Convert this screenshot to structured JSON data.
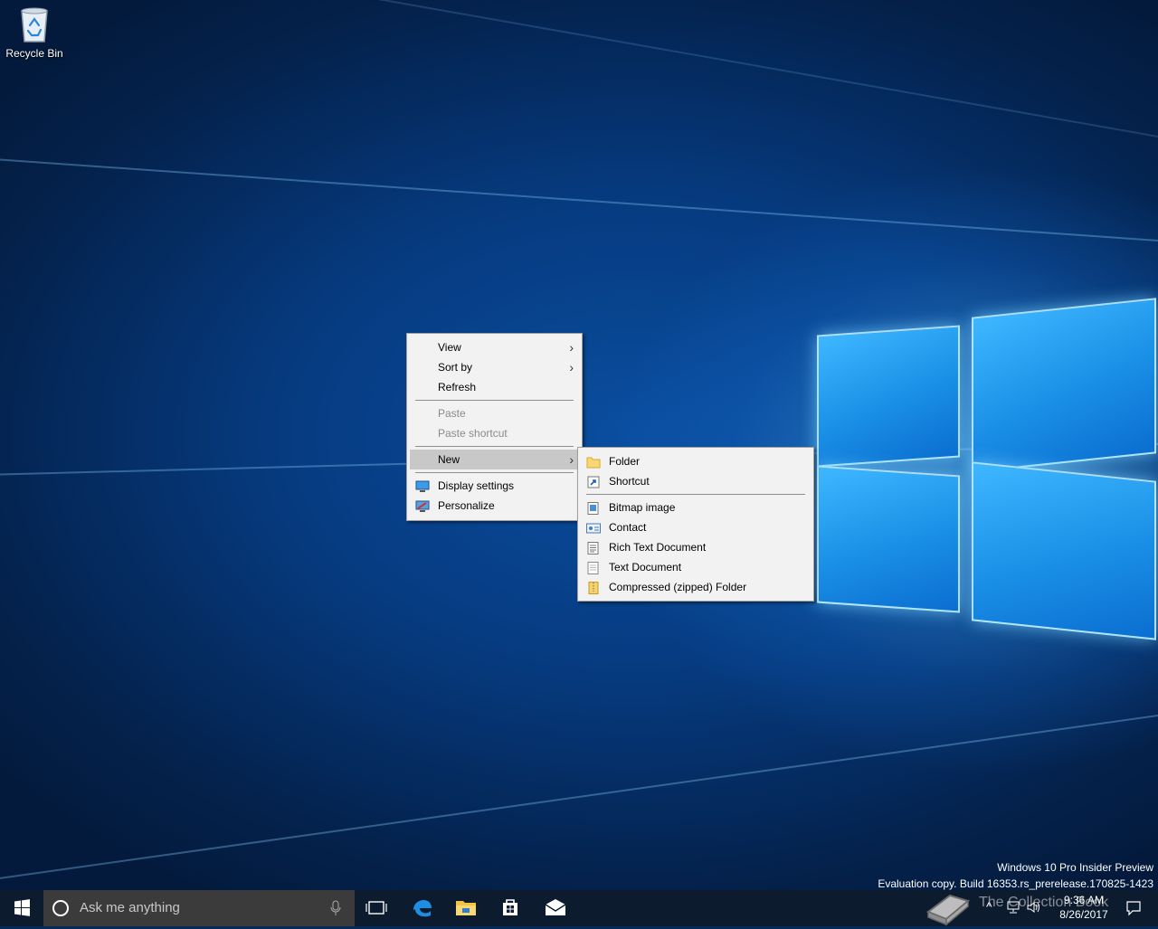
{
  "desktop": {
    "icons": [
      {
        "label": "Recycle Bin"
      }
    ]
  },
  "context_menu": {
    "items": [
      {
        "label": "View",
        "has_submenu": true
      },
      {
        "label": "Sort by",
        "has_submenu": true
      },
      {
        "label": "Refresh"
      },
      {
        "label": "Paste",
        "disabled": true
      },
      {
        "label": "Paste shortcut",
        "disabled": true
      },
      {
        "label": "New",
        "has_submenu": true,
        "active": true
      },
      {
        "label": "Display settings",
        "icon": "display-settings-icon"
      },
      {
        "label": "Personalize",
        "icon": "personalize-icon"
      }
    ]
  },
  "new_submenu": {
    "items": [
      {
        "label": "Folder",
        "icon": "folder-icon"
      },
      {
        "label": "Shortcut",
        "icon": "shortcut-icon"
      },
      {
        "label": "Bitmap image",
        "icon": "bitmap-icon"
      },
      {
        "label": "Contact",
        "icon": "contact-icon"
      },
      {
        "label": "Rich Text Document",
        "icon": "rich-text-icon"
      },
      {
        "label": "Text Document",
        "icon": "text-document-icon"
      },
      {
        "label": "Compressed (zipped) Folder",
        "icon": "zip-folder-icon"
      }
    ]
  },
  "watermark": {
    "line1": "Windows 10 Pro Insider Preview",
    "line2": "Evaluation copy. Build 16353.rs_prerelease.170825-1423"
  },
  "taskbar": {
    "search_placeholder": "Ask me anything",
    "pinned": [
      "task-view",
      "edge",
      "file-explorer",
      "store",
      "mail"
    ],
    "clock": {
      "time": "9:36 AM",
      "date": "8/26/2017"
    },
    "overlay_text": "The Collection Book"
  },
  "colors": {
    "taskbar": "#0d1b2e",
    "search_box": "#3b3b3b",
    "menu_bg": "#f2f2f2",
    "menu_active": "#c8c8c8",
    "accent_blue": "#1a8fe6"
  }
}
